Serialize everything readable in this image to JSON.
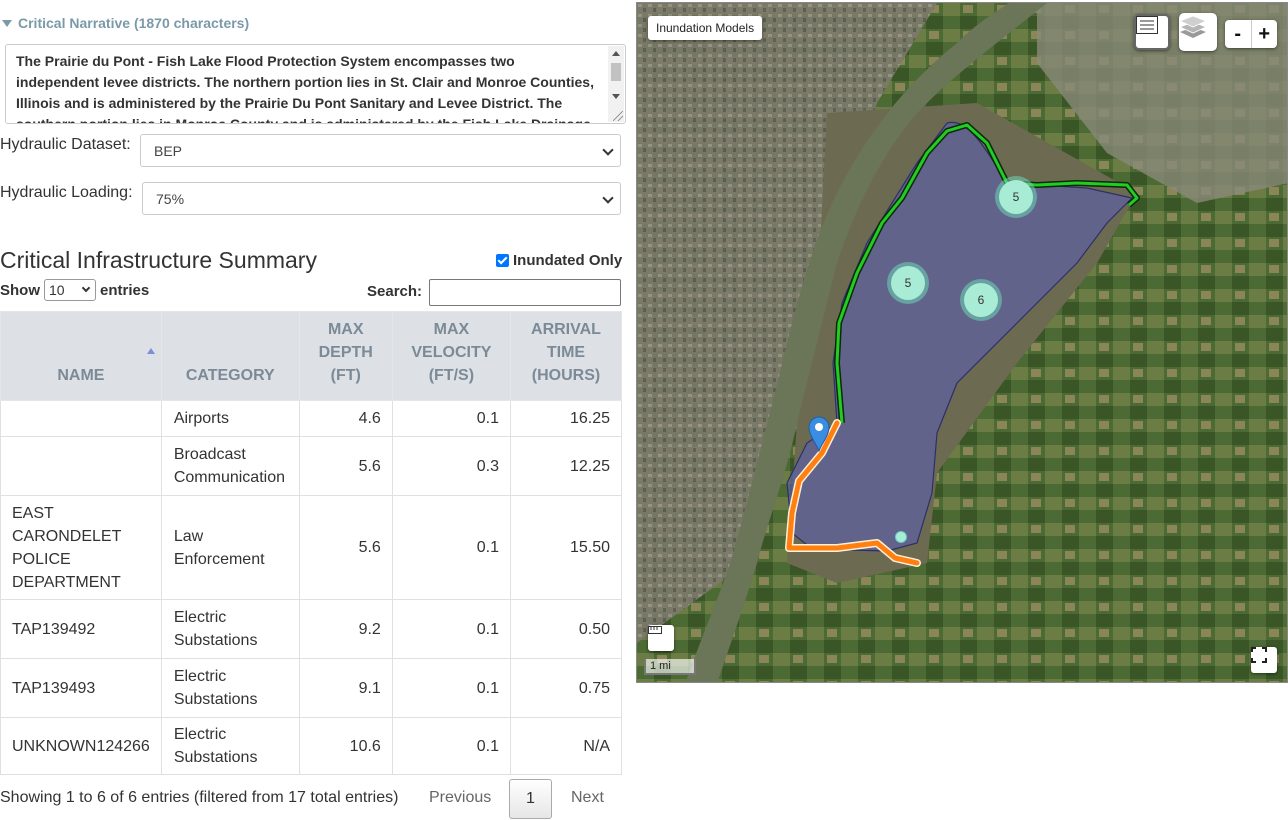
{
  "narrative": {
    "header": "Critical Narrative (1870 characters)",
    "text": "The Prairie du Pont - Fish Lake Flood Protection System encompasses two independent levee districts. The northern portion lies in St. Clair and Monroe Counties, Illinois and is administered by the Prairie Du Pont Sanitary and Levee District. The southern portion lies in Monroe County and is administered by the Fish Lake Drainage and Levee District. The"
  },
  "form": {
    "dataset_label": "Hydraulic Dataset:",
    "dataset_value": "BEP",
    "loading_label": "Hydraulic Loading:",
    "loading_value": "75%"
  },
  "summary": {
    "title": "Critical Infrastructure Summary",
    "inundated_label": "Inundated Only",
    "show_label": "Show",
    "entries_value": "10",
    "entries_label": "entries",
    "search_label": "Search:",
    "columns": {
      "name": "NAME",
      "category": "CATEGORY",
      "depth": [
        "MAX",
        "DEPTH",
        "(FT)"
      ],
      "velocity": [
        "MAX",
        "VELOCITY",
        "(FT/S)"
      ],
      "arrival": [
        "ARRIVAL",
        "TIME",
        "(HOURS)"
      ]
    },
    "rows": [
      {
        "name": [],
        "category": [
          "Airports"
        ],
        "depth": "4.6",
        "velocity": "0.1",
        "arrival": "16.25"
      },
      {
        "name": [],
        "category": [
          "Broadcast",
          "Communication"
        ],
        "depth": "5.6",
        "velocity": "0.3",
        "arrival": "12.25"
      },
      {
        "name": [
          "EAST",
          "CARONDELET",
          "POLICE",
          "DEPARTMENT"
        ],
        "category": [
          "Law",
          "Enforcement"
        ],
        "depth": "5.6",
        "velocity": "0.1",
        "arrival": "15.50"
      },
      {
        "name": [
          "TAP139492"
        ],
        "category": [
          "Electric",
          "Substations"
        ],
        "depth": "9.2",
        "velocity": "0.1",
        "arrival": "0.50"
      },
      {
        "name": [
          "TAP139493"
        ],
        "category": [
          "Electric",
          "Substations"
        ],
        "depth": "9.1",
        "velocity": "0.1",
        "arrival": "0.75"
      },
      {
        "name": [
          "UNKNOWN124266"
        ],
        "category": [
          "Electric",
          "Substations"
        ],
        "depth": "10.6",
        "velocity": "0.1",
        "arrival": "N/A"
      }
    ],
    "info": "Showing 1 to 6 of 6 entries (filtered from 17 total entries)",
    "previous": "Previous",
    "page": "1",
    "next": "Next"
  },
  "map": {
    "title": "Inundation Models",
    "zoom_in": "+",
    "zoom_out": "-",
    "scale": "1 mi",
    "clusters": [
      "5",
      "5",
      "6"
    ],
    "icons": [
      "legend-icon",
      "layers-icon",
      "ruler-icon",
      "fullscreen-icon",
      "location-pin-icon"
    ],
    "colors": {
      "north_levee": "#22cc22",
      "south_levee": "#ff7f11",
      "inundation": "#5a5fae",
      "cluster": "#a8ecd6",
      "pin": "#3a8de0"
    }
  }
}
